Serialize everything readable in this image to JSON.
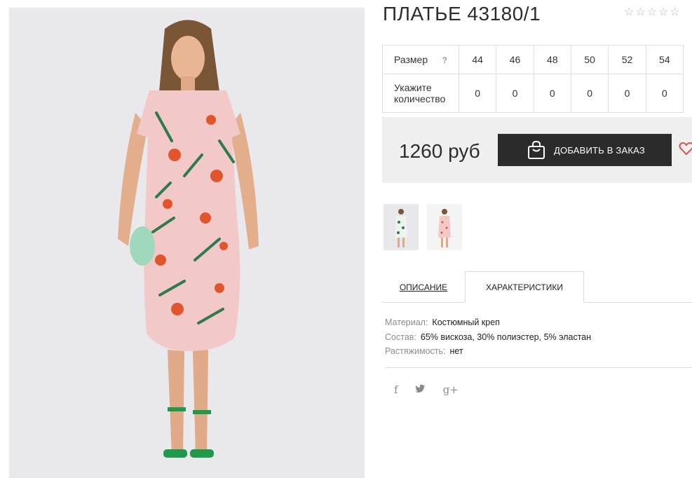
{
  "product": {
    "title": "ПЛАТЬЕ 43180/1",
    "rating_stars": [
      "☆",
      "☆",
      "☆",
      "☆",
      "☆"
    ],
    "rating_value": 0
  },
  "sizes": {
    "row_label": "Размер",
    "help": "?",
    "values": [
      "44",
      "46",
      "48",
      "50",
      "52",
      "54"
    ],
    "qty_label_line1": "Укажите",
    "qty_label_line2": "количество",
    "quantities": [
      "0",
      "0",
      "0",
      "0",
      "0",
      "0"
    ]
  },
  "purchase": {
    "price": "1260 руб",
    "add_button": "ДОБАВИТЬ В ЗАКАЗ"
  },
  "tabs": {
    "description": "ОПИСАНИЕ",
    "characteristics": "ХАРАКТЕРИСТИКИ",
    "active": "characteristics"
  },
  "characteristics": [
    {
      "key": "Материал:",
      "value": "Костюмный креп"
    },
    {
      "key": "Состав:",
      "value": "65% вискоза, 30% полиэстер, 5% эластан"
    },
    {
      "key": "Растяжимость:",
      "value": "нет"
    }
  ],
  "social": {
    "facebook": "f",
    "twitter": "ᵛ",
    "google_plus": "g+"
  },
  "colors": {
    "button_bg": "#2b2b2b",
    "panel_bg": "#efefef",
    "dress_pink": "#f2c9c8",
    "sandals_green": "#1f9a4a"
  }
}
